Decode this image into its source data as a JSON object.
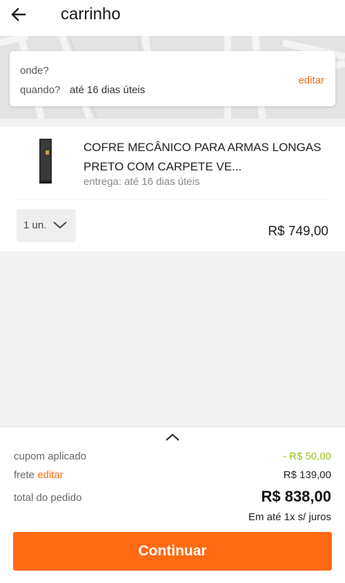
{
  "header": {
    "title": "carrinho",
    "back_icon": "arrow-left-icon"
  },
  "delivery": {
    "where_label": "onde?",
    "when_label": "quando?",
    "when_value": "até 16 dias úteis",
    "edit_label": "editar"
  },
  "product": {
    "name": "COFRE MECÂNICO PARA ARMAS LONGAS PRETO COM CARPETE VE...",
    "delivery": "entrega: até 16 dias úteis",
    "quantity": "1 un.",
    "quantity_icon": "chevron-down-icon",
    "price": "R$ 749,00"
  },
  "summary": {
    "collapse_icon": "chevron-up-icon",
    "coupon_label": "cupom aplicado",
    "coupon_value": "- R$ 50,00",
    "shipping_label": "frete",
    "shipping_edit": "editar",
    "shipping_value": "R$ 139,00",
    "total_label": "total do pedido",
    "total_value": "R$ 838,00",
    "installments": "Em até 1x s/ juros",
    "continue_label": "Continuar"
  },
  "colors": {
    "accent": "#ff6a13",
    "coupon": "#9ac31c"
  }
}
